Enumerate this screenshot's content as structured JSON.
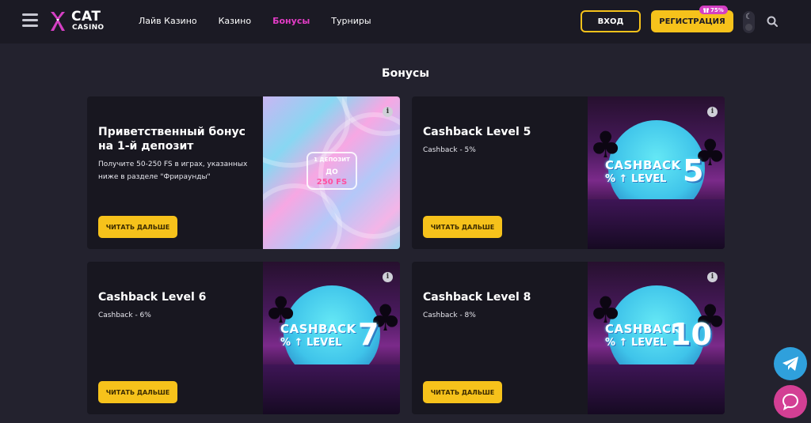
{
  "header": {
    "logo": {
      "cat": "CAT",
      "casino": "CASINO"
    },
    "nav": [
      {
        "label": "Лайв Казино",
        "active": false
      },
      {
        "label": "Казино",
        "active": false
      },
      {
        "label": "Бонусы",
        "active": true
      },
      {
        "label": "Турниры",
        "active": false
      }
    ],
    "login_label": "ВХОД",
    "register_label": "РЕГИСТРАЦИЯ",
    "register_badge": "75%",
    "icons": {
      "menu": "hamburger-icon",
      "theme": "moon-icon",
      "search": "search-icon",
      "gift": "gift-icon"
    }
  },
  "page": {
    "title": "Бонусы"
  },
  "cards": [
    {
      "title": "Приветственный бонус на 1-й депозит",
      "description": "Получите 50-250 FS в играх, указанных ниже в разделе \"Фрираунды\"",
      "button": "ЧИТАТЬ ДАЛЬШЕ",
      "image": {
        "deposit": "1 ДЕПОЗИТ",
        "do": "ДО",
        "fs": "250 FS"
      }
    },
    {
      "title": "Cashback Level 5",
      "description": "Cashback - 5%",
      "button": "ЧИТАТЬ ДАЛЬШЕ",
      "image": {
        "cashback": "CASHBACK",
        "level": "LEVEL",
        "percent": "%",
        "number": "5"
      }
    },
    {
      "title": "Cashback Level 6",
      "description": "Cashback - 6%",
      "button": "ЧИТАТЬ ДАЛЬШЕ",
      "image": {
        "cashback": "CASHBACK",
        "level": "LEVEL",
        "percent": "%",
        "number": "7"
      }
    },
    {
      "title": "Cashback Level 8",
      "description": "Cashback - 8%",
      "button": "ЧИТАТЬ ДАЛЬШЕ",
      "image": {
        "cashback": "CASHBACK",
        "level": "LEVEL",
        "percent": "%",
        "number": "10"
      }
    }
  ],
  "colors": {
    "accent_yellow": "#f6c21b",
    "accent_pink": "#e43cc7",
    "background": "#23222e",
    "card": "#181720",
    "telegram": "#2fa0dc",
    "chat": "#d33f94"
  },
  "floating": {
    "telegram_icon": "telegram-icon",
    "chat_icon": "chat-icon"
  }
}
